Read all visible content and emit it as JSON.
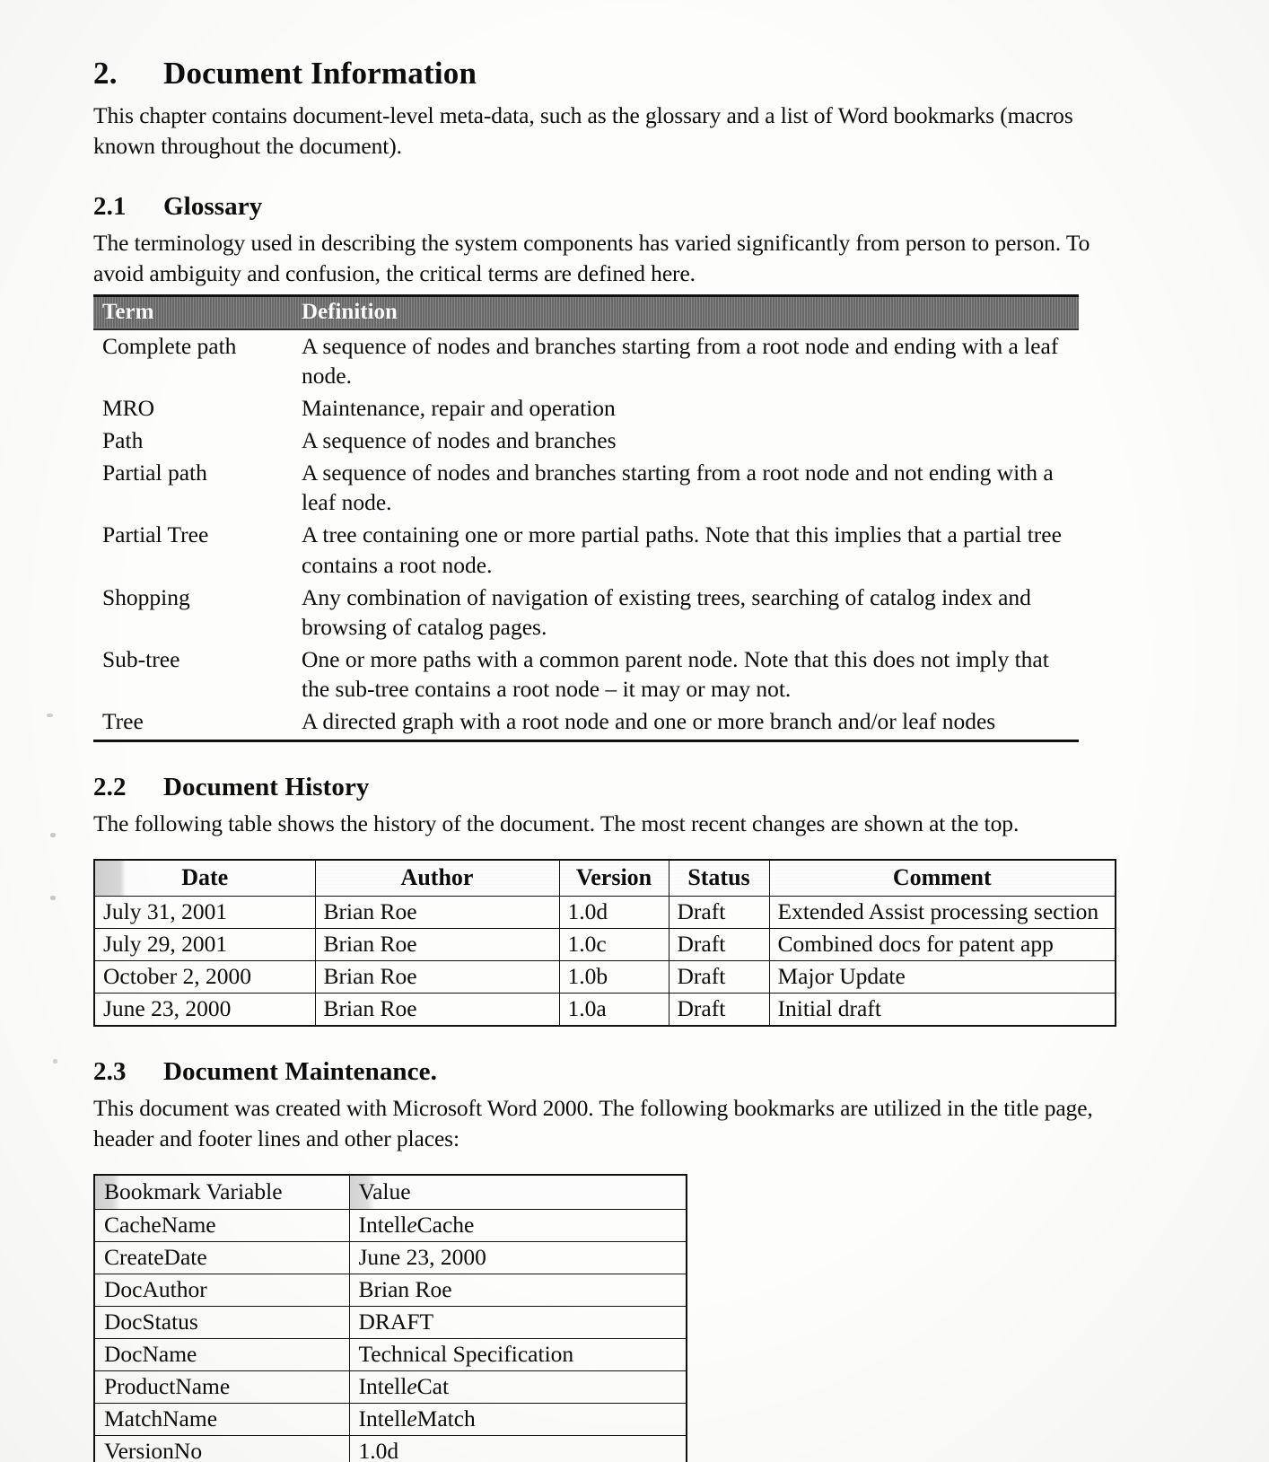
{
  "chapter": {
    "number": "2.",
    "title": "Document Information",
    "intro": "This chapter contains document-level meta-data, such as the glossary and a list of Word bookmarks (macros known throughout the document)."
  },
  "glossary": {
    "number": "2.1",
    "title": "Glossary",
    "intro": "The terminology used in describing the system components has varied significantly from person to person.  To avoid ambiguity and confusion, the critical terms are defined here.",
    "columns": [
      "Term",
      "Definition"
    ],
    "rows": [
      {
        "term": "Complete path",
        "definition": "A sequence of nodes and branches starting from a root node and ending with a leaf node."
      },
      {
        "term": "MRO",
        "definition": "Maintenance, repair and operation"
      },
      {
        "term": "Path",
        "definition": "A sequence of nodes and branches"
      },
      {
        "term": "Partial path",
        "definition": "A sequence of nodes and branches starting from a root node and not ending with a leaf node."
      },
      {
        "term": "Partial Tree",
        "definition": "A tree containing one or more partial paths.  Note that this implies that a partial tree contains a root node."
      },
      {
        "term": "Shopping",
        "definition": "Any combination of navigation of existing trees, searching of catalog index and browsing of catalog pages."
      },
      {
        "term": "Sub-tree",
        "definition": "One or more paths with a common parent node.  Note that this does not imply that the sub-tree contains a root node – it may or may not."
      },
      {
        "term": "Tree",
        "definition": "A directed graph with a root node and one or more branch and/or leaf nodes"
      }
    ]
  },
  "history": {
    "number": "2.2",
    "title": "Document History",
    "intro": "The following table shows the history of the document.  The most recent changes are shown at the top.",
    "columns": [
      "Date",
      "Author",
      "Version",
      "Status",
      "Comment"
    ],
    "rows": [
      {
        "date": "July 31, 2001",
        "author": "Brian Roe",
        "version": "1.0d",
        "status": "Draft",
        "comment": "Extended Assist processing section"
      },
      {
        "date": "July 29, 2001",
        "author": "Brian Roe",
        "version": "1.0c",
        "status": "Draft",
        "comment": "Combined docs for patent app"
      },
      {
        "date": "October 2, 2000",
        "author": "Brian Roe",
        "version": "1.0b",
        "status": "Draft",
        "comment": "Major Update"
      },
      {
        "date": "June 23, 2000",
        "author": "Brian Roe",
        "version": "1.0a",
        "status": "Draft",
        "comment": "Initial draft"
      }
    ]
  },
  "maintenance": {
    "number": "2.3",
    "title": "Document Maintenance.",
    "intro": "This document was created with Microsoft Word 2000. The following bookmarks are utilized in the title page, header and footer lines and other places:",
    "columns": [
      "Bookmark Variable",
      "Value"
    ],
    "rows": [
      {
        "variable": "CacheName",
        "value": "IntelleCache",
        "value_pre": "Intell",
        "value_italic": "e",
        "value_post": "Cache"
      },
      {
        "variable": "CreateDate",
        "value": "June 23, 2000",
        "value_pre": "June 23, 2000",
        "value_italic": "",
        "value_post": ""
      },
      {
        "variable": "DocAuthor",
        "value": "Brian Roe",
        "value_pre": "Brian Roe",
        "value_italic": "",
        "value_post": ""
      },
      {
        "variable": "DocStatus",
        "value": "DRAFT",
        "value_pre": "DRAFT",
        "value_italic": "",
        "value_post": ""
      },
      {
        "variable": "DocName",
        "value": "Technical Specification",
        "value_pre": "Technical Specification",
        "value_italic": "",
        "value_post": ""
      },
      {
        "variable": "ProductName",
        "value": "IntelleCat",
        "value_pre": "Intell",
        "value_italic": "e",
        "value_post": "Cat"
      },
      {
        "variable": "MatchName",
        "value": "IntelleMatch",
        "value_pre": "Intell",
        "value_italic": "e",
        "value_post": "Match"
      },
      {
        "variable": "VersionNo",
        "value": "1.0d",
        "value_pre": "1.0d",
        "value_italic": "",
        "value_post": ""
      }
    ]
  }
}
